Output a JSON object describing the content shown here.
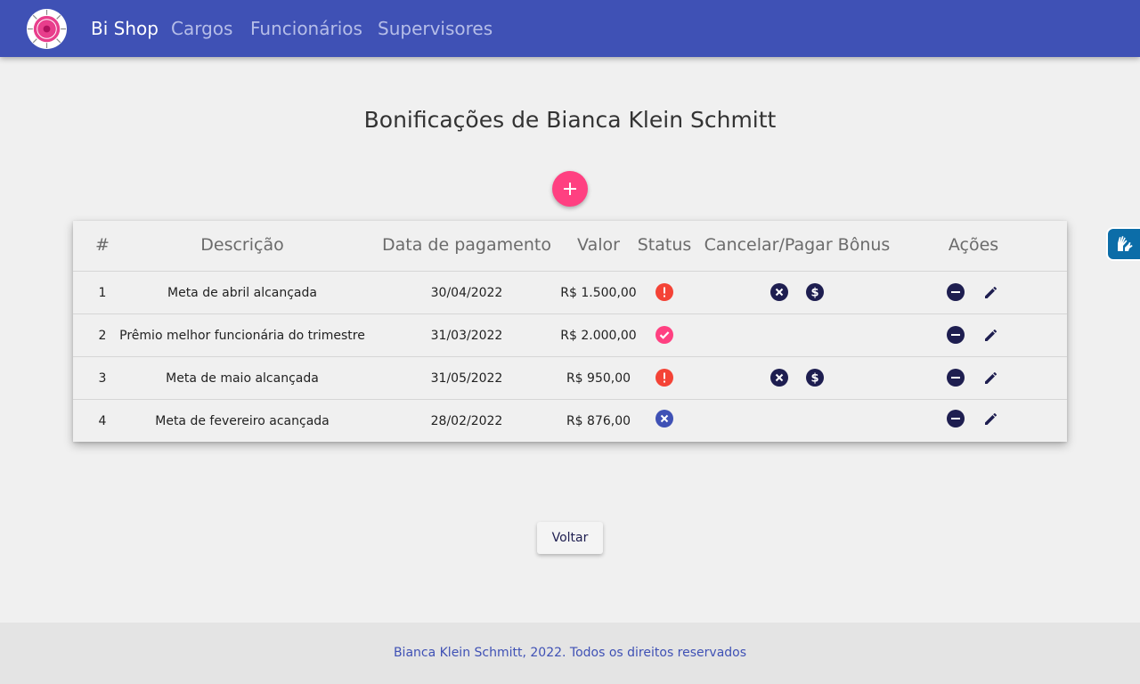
{
  "nav": {
    "brand": "Bi Shop",
    "links": [
      "Cargos",
      "Funcionários",
      "Supervisores"
    ]
  },
  "page": {
    "title": "Bonificações de Bianca Klein Schmitt"
  },
  "table": {
    "headers": {
      "num": "#",
      "descricao": "Descrição",
      "data": "Data de pagamento",
      "valor": "Valor",
      "status": "Status",
      "cancelar_pagar": "Cancelar/Pagar Bônus",
      "acoes": "Ações"
    },
    "rows": [
      {
        "num": "1",
        "descricao": "Meta de abril alcançada",
        "data": "30/04/2022",
        "valor": "R$ 1.500,00",
        "status": "pending-alert-icon"
      },
      {
        "num": "2",
        "descricao": "Prêmio melhor funcionária do trimestre",
        "data": "31/03/2022",
        "valor": "R$ 2.000,00",
        "status": "paid-check-icon"
      },
      {
        "num": "3",
        "descricao": "Meta de maio alcançada",
        "data": "31/05/2022",
        "valor": "R$ 950,00",
        "status": "pending-alert-icon"
      },
      {
        "num": "4",
        "descricao": "Meta de fevereiro acançada",
        "data": "28/02/2022",
        "valor": "R$ 876,00",
        "status": "cancelled-x-icon"
      }
    ]
  },
  "buttons": {
    "voltar": "Voltar"
  },
  "footer": {
    "text": "Bianca Klein Schmitt, 2022. Todos os direitos reservados"
  },
  "colors": {
    "primary": "#3f51b5",
    "accent": "#ff4081",
    "dark_icon": "#1e1e50",
    "alert": "#f44336",
    "check": "#ff4081",
    "cancelled": "#3f51b5"
  }
}
